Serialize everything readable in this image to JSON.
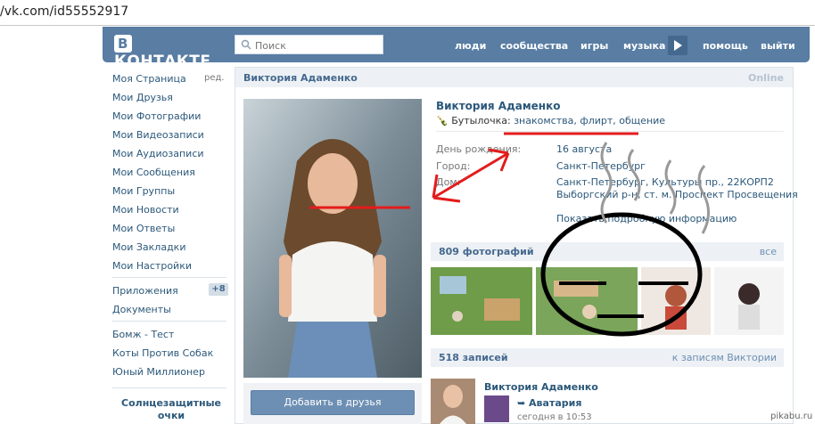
{
  "browser": {
    "url": "/vk.com/id55552917"
  },
  "header": {
    "logo_text": "КОНТАКТЕ",
    "logo_letter": "В",
    "search_placeholder": "Поиск",
    "nav": [
      "люди",
      "сообщества",
      "игры",
      "музыка",
      "помощь",
      "выйти"
    ],
    "colors": {
      "bar": "#597da3",
      "link": "#2b587a"
    }
  },
  "sidebar": {
    "items": [
      "Моя Страница",
      "Мои Друзья",
      "Мои Фотографии",
      "Мои Видеозаписи",
      "Мои Аудиозаписи",
      "Мои Сообщения",
      "Мои Группы",
      "Мои Новости",
      "Мои Ответы",
      "Мои Закладки",
      "Мои Настройки"
    ],
    "edit_label": "ред.",
    "apps": [
      "Приложения",
      "Документы"
    ],
    "apps_badge": "+8",
    "games": [
      "Бомж - Тест",
      "Коты Против Собак",
      "Юный Миллионер"
    ],
    "promo": "Солнцезащитные очки"
  },
  "profile": {
    "header_name": "Виктория Адаменко",
    "online": "Online",
    "name": "Виктория Адаменко",
    "status_prefix": "Бутылочка: ",
    "status_link": "знакомства, флирт, общение",
    "add_friend": "Добавить в друзья",
    "info": [
      {
        "label": "День рождения:",
        "value": "16 августа"
      },
      {
        "label": "Город:",
        "value": "Санкт-Петербург"
      },
      {
        "label": "Дом:",
        "value": "Санкт-Петербург, Культуры пр., 22КОРП2"
      },
      {
        "label": "",
        "value": "Выборгский р-н, ст. м. Проспект Просвещения"
      }
    ],
    "more_info": "Показать подробную информацию",
    "photos_title": "809 фотографий",
    "photos_all": "все",
    "wall_title": "518 записей",
    "wall_link": "к записям Виктории",
    "post_author": "Виктория Адаменко",
    "post_app": "Аватария",
    "post_time": "сегодня в 10:53"
  },
  "watermark": "pikabu.ru"
}
